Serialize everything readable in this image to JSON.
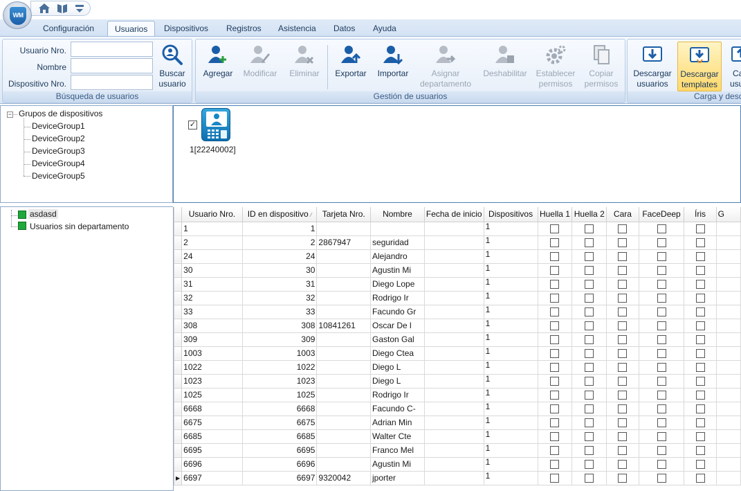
{
  "tabs": [
    "Configuración",
    "Usuarios",
    "Dispositivos",
    "Registros",
    "Asistencia",
    "Datos",
    "Ayuda"
  ],
  "active_tab": "Usuarios",
  "logo_text": "WM",
  "search_group": {
    "labels": [
      "Usuario Nro.",
      "Nombre",
      "Dispositivo Nro."
    ],
    "button_line1": "Buscar",
    "button_line2": "usuario",
    "caption": "Búsqueda de usuarios"
  },
  "user_management": {
    "caption": "Gestión de usuarios",
    "buttons": [
      {
        "line1": "Agregar",
        "line2": ""
      },
      {
        "line1": "Modificar",
        "line2": ""
      },
      {
        "line1": "Eliminar",
        "line2": ""
      },
      {
        "line1": "Exportar",
        "line2": ""
      },
      {
        "line1": "Importar",
        "line2": ""
      },
      {
        "line1": "Asignar",
        "line2": "departamento"
      },
      {
        "line1": "Deshabilitar",
        "line2": ""
      },
      {
        "line1": "Establecer",
        "line2": "permisos"
      },
      {
        "line1": "Copiar",
        "line2": "permisos"
      }
    ]
  },
  "upload_group": {
    "caption": "Carga y desc",
    "buttons": [
      {
        "line1": "Descargar",
        "line2": "usuarios"
      },
      {
        "line1": "Descargar",
        "line2": "templates"
      },
      {
        "line1": "Ca",
        "line2": "usu"
      }
    ]
  },
  "device_tree": {
    "root": "Grupos de dispositivos",
    "groups": [
      "DeviceGroup1",
      "DeviceGroup2",
      "DeviceGroup3",
      "DeviceGroup4",
      "DeviceGroup5"
    ]
  },
  "device": {
    "label": "1[22240002]",
    "checked_glyph": "✓"
  },
  "departments": [
    "asdasd",
    "Usuarios sin departamento"
  ],
  "grid": {
    "columns": [
      "Usuario Nro.",
      "ID en dispositivo",
      "Tarjeta Nro.",
      "Nombre",
      "Fecha de inicio",
      "Dispositivos",
      "Huella 1",
      "Huella 2",
      "Cara",
      "FaceDeep",
      "Íris",
      "G"
    ],
    "sort_glyph": "⁄",
    "current_row_glyph": "▶",
    "rows": [
      {
        "usuario": "1",
        "id": "1",
        "tarjeta": "",
        "nombre": "",
        "fecha": "",
        "dispositivos": "1"
      },
      {
        "usuario": "2",
        "id": "2",
        "tarjeta": "2867947",
        "nombre": "seguridad",
        "fecha": "",
        "dispositivos": "1"
      },
      {
        "usuario": "24",
        "id": "24",
        "tarjeta": "",
        "nombre": "Alejandro",
        "fecha": "",
        "dispositivos": "1"
      },
      {
        "usuario": "30",
        "id": "30",
        "tarjeta": "",
        "nombre": "Agustin Mi",
        "fecha": "",
        "dispositivos": "1"
      },
      {
        "usuario": "31",
        "id": "31",
        "tarjeta": "",
        "nombre": "Diego Lope",
        "fecha": "",
        "dispositivos": "1"
      },
      {
        "usuario": "32",
        "id": "32",
        "tarjeta": "",
        "nombre": "Rodrigo Ir",
        "fecha": "",
        "dispositivos": "1"
      },
      {
        "usuario": "33",
        "id": "33",
        "tarjeta": "",
        "nombre": "Facundo Gr",
        "fecha": "",
        "dispositivos": "1"
      },
      {
        "usuario": "308",
        "id": "308",
        "tarjeta": "10841261",
        "nombre": "Oscar De l",
        "fecha": "",
        "dispositivos": "1"
      },
      {
        "usuario": "309",
        "id": "309",
        "tarjeta": "",
        "nombre": "Gaston Gal",
        "fecha": "",
        "dispositivos": "1"
      },
      {
        "usuario": "1003",
        "id": "1003",
        "tarjeta": "",
        "nombre": "Diego Ctea",
        "fecha": "",
        "dispositivos": "1"
      },
      {
        "usuario": "1022",
        "id": "1022",
        "tarjeta": "",
        "nombre": "Diego L",
        "fecha": "",
        "dispositivos": "1"
      },
      {
        "usuario": "1023",
        "id": "1023",
        "tarjeta": "",
        "nombre": "Diego L",
        "fecha": "",
        "dispositivos": "1"
      },
      {
        "usuario": "1025",
        "id": "1025",
        "tarjeta": "",
        "nombre": "Rodrigo Ir",
        "fecha": "",
        "dispositivos": "1"
      },
      {
        "usuario": "6668",
        "id": "6668",
        "tarjeta": "",
        "nombre": "Facundo C-",
        "fecha": "",
        "dispositivos": "1"
      },
      {
        "usuario": "6675",
        "id": "6675",
        "tarjeta": "",
        "nombre": "Adrian Min",
        "fecha": "",
        "dispositivos": "1"
      },
      {
        "usuario": "6685",
        "id": "6685",
        "tarjeta": "",
        "nombre": "Walter Cte",
        "fecha": "",
        "dispositivos": "1"
      },
      {
        "usuario": "6695",
        "id": "6695",
        "tarjeta": "",
        "nombre": "Franco Mel",
        "fecha": "",
        "dispositivos": "1"
      },
      {
        "usuario": "6696",
        "id": "6696",
        "tarjeta": "",
        "nombre": "Agustin Mi",
        "fecha": "",
        "dispositivos": "1"
      },
      {
        "usuario": "6697",
        "id": "6697",
        "tarjeta": "9320042",
        "nombre": "jporter",
        "fecha": "",
        "dispositivos": "1"
      }
    ]
  },
  "colors": {
    "accent": "#1b5ea8",
    "department": "#1fa83b",
    "highlight": "#ffd96b"
  }
}
